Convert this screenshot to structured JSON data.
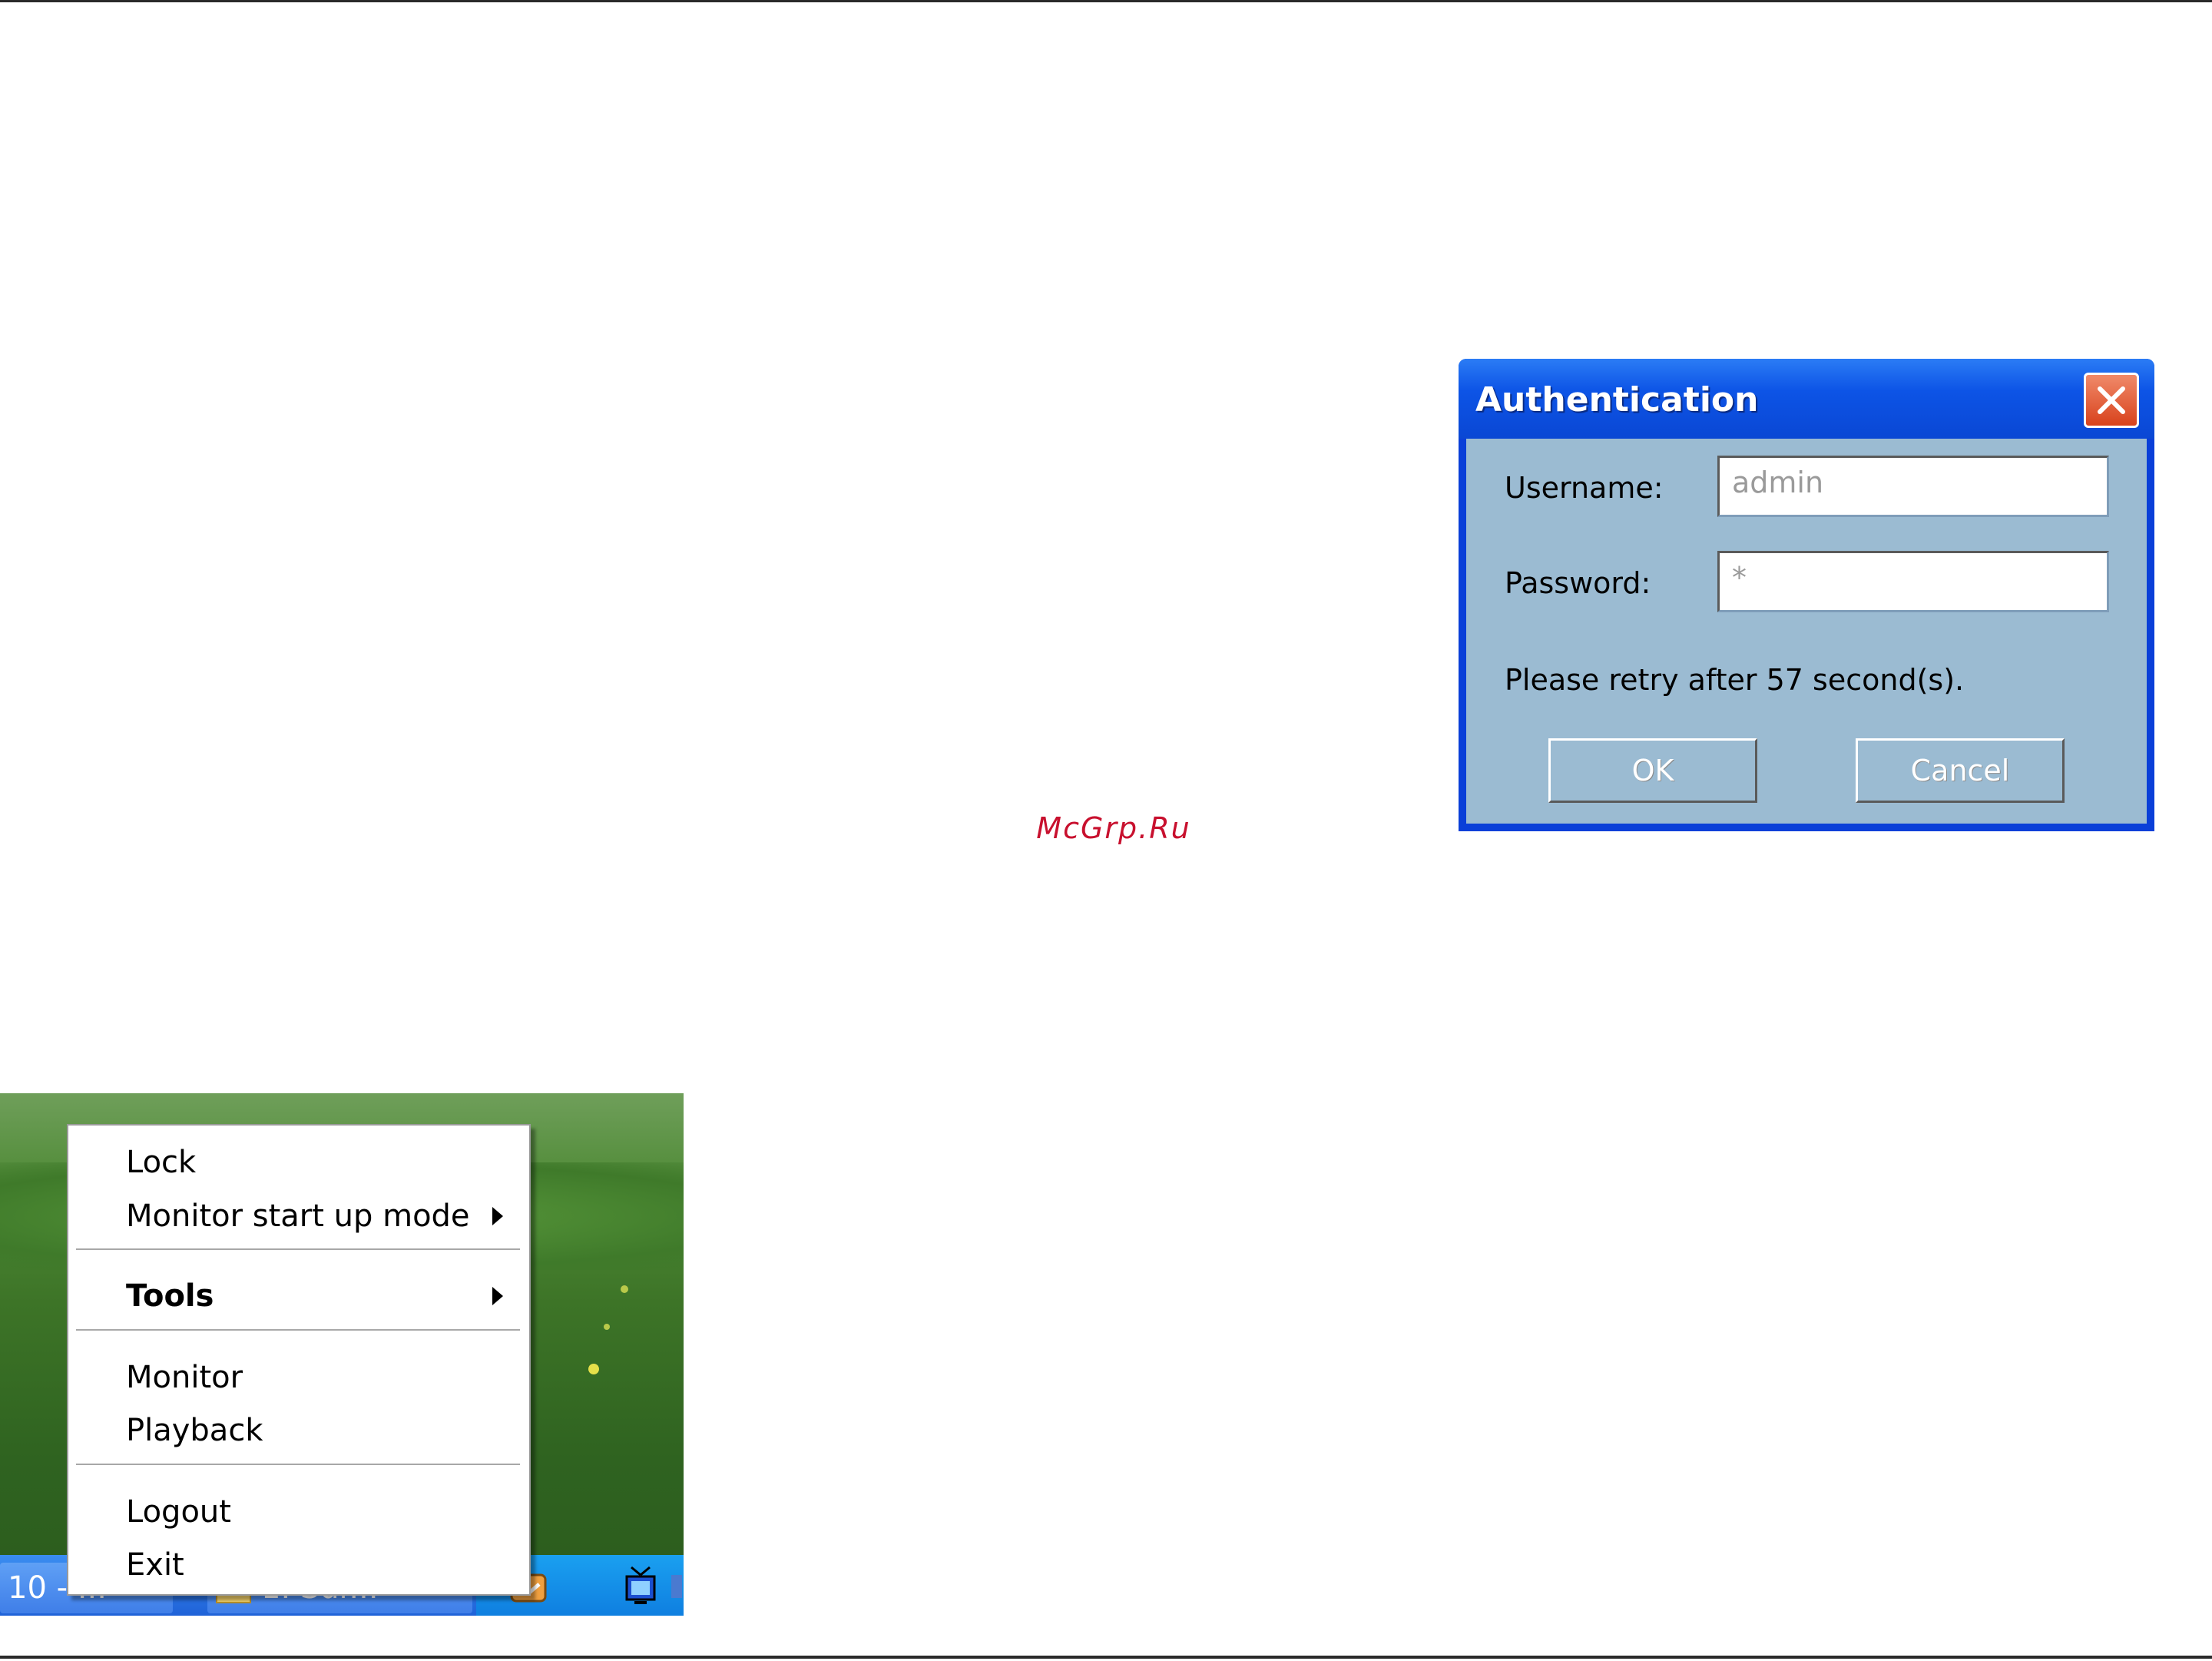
{
  "watermark": "McGrp.Ru",
  "dialog": {
    "title": "Authentication",
    "username_label": "Username:",
    "username_value": "admin",
    "password_label": "Password:",
    "password_value": "*",
    "retry_message": "Please retry after 57 second(s).",
    "ok_label": "OK",
    "cancel_label": "Cancel",
    "titlebar_color": "#0d54e6",
    "body_color": "#9bbbd2",
    "close_color": "#d8421c"
  },
  "context_menu": {
    "items": [
      {
        "label": "Lock",
        "bold": false,
        "submenu": false
      },
      {
        "label": "Monitor start up mode",
        "bold": false,
        "submenu": true
      },
      {
        "label": "Tools",
        "bold": true,
        "submenu": true
      },
      {
        "label": "Monitor",
        "bold": false,
        "submenu": false
      },
      {
        "label": "Playback",
        "bold": false,
        "submenu": false
      },
      {
        "label": "Logout",
        "bold": false,
        "submenu": false
      },
      {
        "label": "Exit",
        "bold": false,
        "submenu": false
      }
    ]
  },
  "taskbar": {
    "buttons": [
      {
        "label": "10 - ..."
      },
      {
        "label": "1. Sur..."
      }
    ],
    "icons": [
      "folder-icon",
      "network-icon",
      "monitor-icon",
      "speaker-icon"
    ]
  }
}
